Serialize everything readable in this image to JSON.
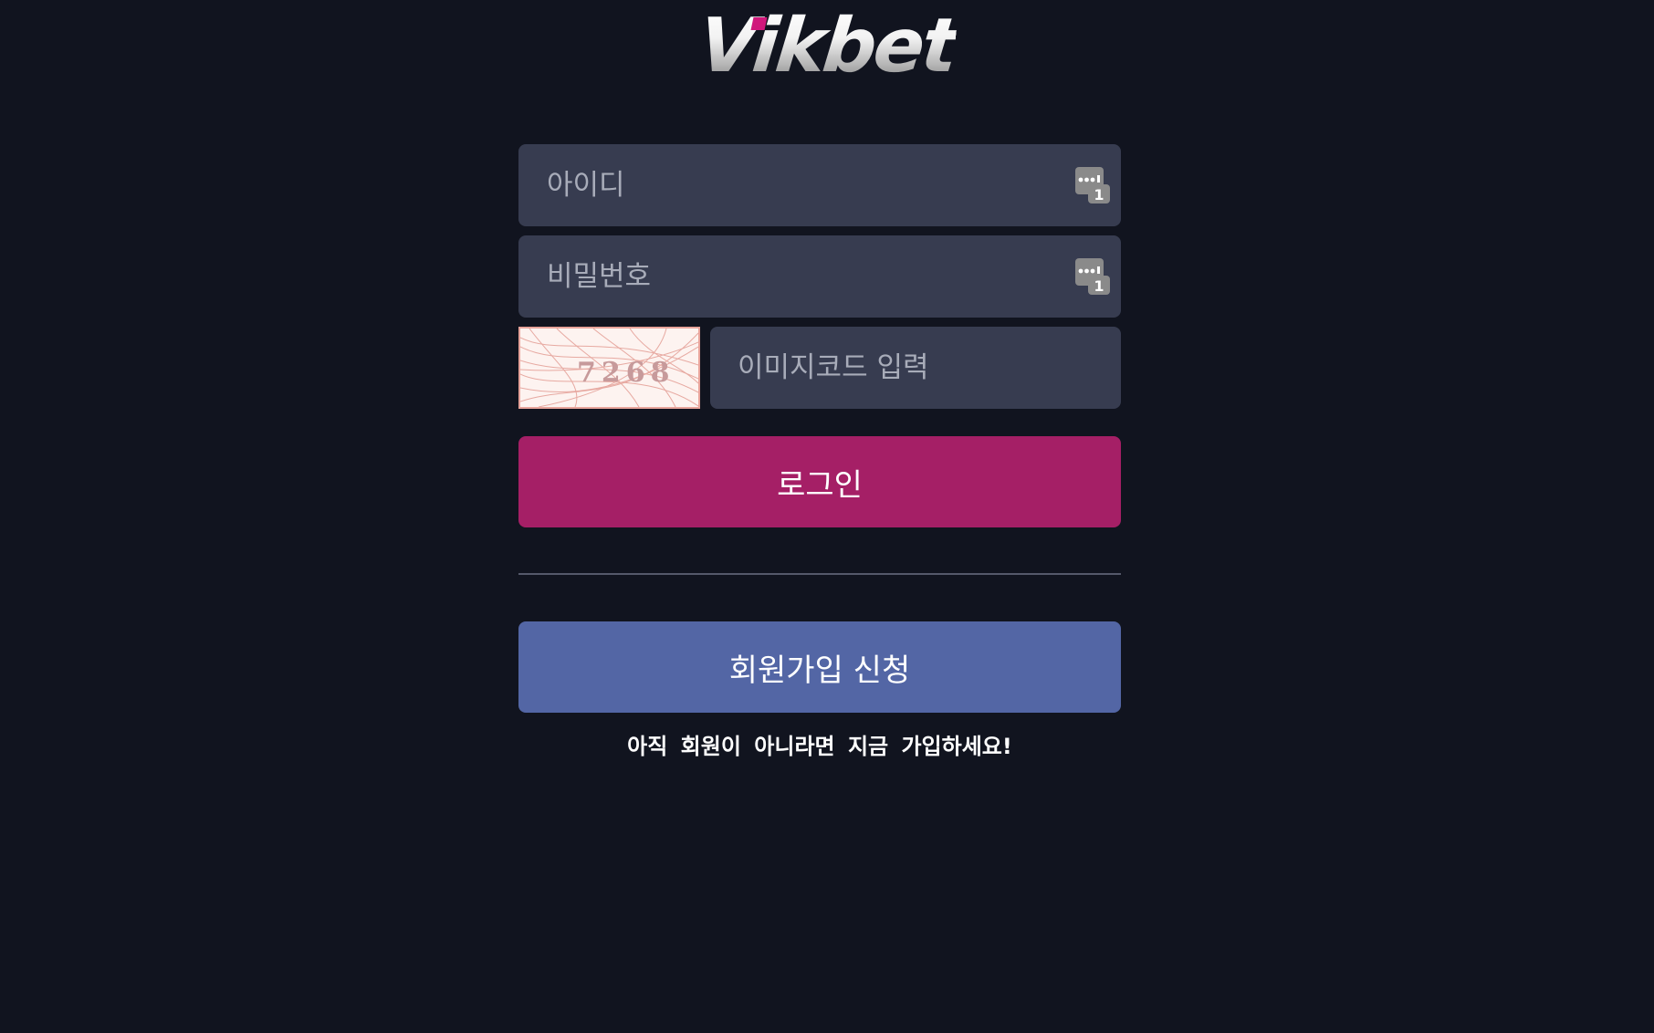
{
  "logo": {
    "text": "Vikbet",
    "accent_color": "#d0177b"
  },
  "login_form": {
    "username": {
      "placeholder": "아이디",
      "value": "",
      "icon": "password-manager-icon"
    },
    "password": {
      "placeholder": "비밀번호",
      "value": "",
      "icon": "password-manager-icon"
    },
    "captcha": {
      "image_code": "7268",
      "placeholder": "이미지코드 입력",
      "value": ""
    },
    "login_label": "로그인"
  },
  "signup": {
    "button_label": "회원가입 신청",
    "note": "아직 회원이 아니라면 지금 가입하세요!"
  },
  "colors": {
    "background": "#11141f",
    "input_bg": "#373c50",
    "login_button": "#a51f66",
    "signup_button": "#5366a5"
  }
}
